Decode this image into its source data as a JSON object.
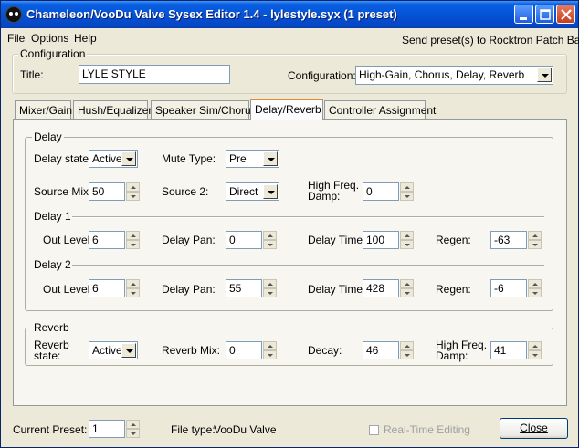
{
  "window": {
    "title": "Chameleon/VooDu Valve Sysex Editor 1.4 - lylestyle.syx (1 preset)"
  },
  "menu": {
    "items": [
      "File",
      "Options",
      "Help"
    ],
    "send_presets": "Send preset(s) to Rocktron Patch Bay"
  },
  "configuration": {
    "group_label": "Configuration",
    "title_label": "Title:",
    "title_value": "LYLE STYLE",
    "config_label": "Configuration:",
    "config_value": "High-Gain, Chorus, Delay, Reverb"
  },
  "tabs": [
    {
      "label": "Mixer/Gain",
      "active": false
    },
    {
      "label": "Hush/Equalizer",
      "active": false
    },
    {
      "label": "Speaker Sim/Chorus",
      "active": false
    },
    {
      "label": "Delay/Reverb",
      "active": true
    },
    {
      "label": "Controller Assignment",
      "active": false
    }
  ],
  "delay": {
    "group_label": "Delay",
    "state_label": "Delay state:",
    "state_value": "Active",
    "mute_type_label": "Mute Type:",
    "mute_type_value": "Pre",
    "source_mix_label": "Source Mix:",
    "source_mix_value": "50",
    "source2_label": "Source 2:",
    "source2_value": "Direct",
    "hf_damp_label_1": "High Freq.",
    "hf_damp_label_2": "Damp:",
    "hf_damp_value": "0",
    "delay1": {
      "heading": "Delay 1",
      "out_level_label": "Out Level:",
      "out_level_value": "6",
      "pan_label": "Delay Pan:",
      "pan_value": "0",
      "time_label": "Delay Time:",
      "time_value": "100",
      "regen_label": "Regen:",
      "regen_value": "-63"
    },
    "delay2": {
      "heading": "Delay 2",
      "out_level_label": "Out Level:",
      "out_level_value": "6",
      "pan_label": "Delay Pan:",
      "pan_value": "55",
      "time_label": "Delay Time:",
      "time_value": "428",
      "regen_label": "Regen:",
      "regen_value": "-6"
    }
  },
  "reverb": {
    "group_label": "Reverb",
    "state_label_1": "Reverb",
    "state_label_2": "state:",
    "state_value": "Active",
    "mix_label": "Reverb Mix:",
    "mix_value": "0",
    "decay_label": "Decay:",
    "decay_value": "46",
    "hf_damp_label_1": "High Freq.",
    "hf_damp_label_2": "Damp:",
    "hf_damp_value": "41"
  },
  "footer": {
    "current_preset_label": "Current Preset:",
    "current_preset_value": "1",
    "file_type_label": "File type:",
    "file_type_value": "VooDu Valve",
    "realtime_label": "Real-Time Editing",
    "close_label": "Close"
  },
  "colors": {
    "titlebar": "#0553d6",
    "active_tab_accent": "#e68b2c",
    "window_bg": "#ece9d8"
  }
}
